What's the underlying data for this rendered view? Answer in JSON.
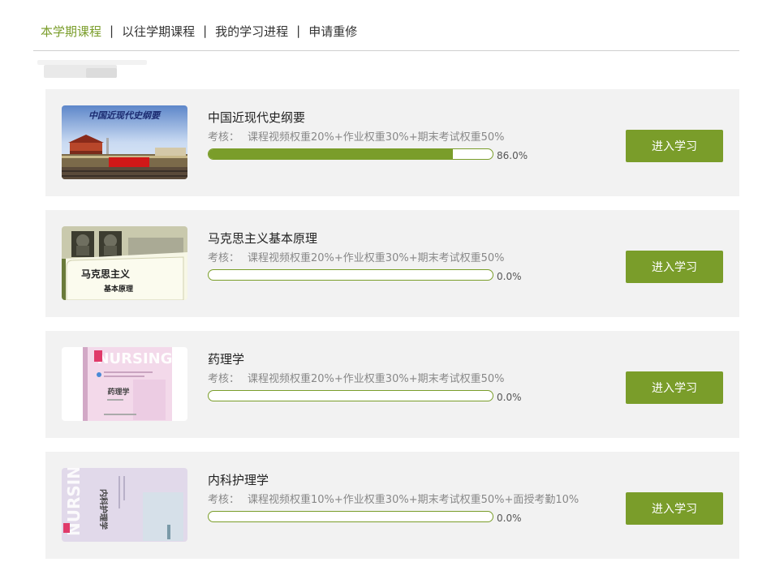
{
  "tabs": [
    {
      "label": "本学期课程",
      "active": true
    },
    {
      "label": "以往学期课程",
      "active": false
    },
    {
      "label": "我的学习进程",
      "active": false
    },
    {
      "label": "申请重修",
      "active": false
    }
  ],
  "tab_separator": "|",
  "colors": {
    "accent": "#7a9d2a",
    "card_bg": "#f2f2f2",
    "muted_text": "#888888"
  },
  "courses": [
    {
      "title": "中国近现代史纲要",
      "assess_label": "考核：",
      "assess": "课程视频权重20%+作业权重30%+期末考试权重50%",
      "progress": 86.0,
      "progress_text": "86.0%",
      "button": "进入学习",
      "cover_text": "中国近现代史纲要"
    },
    {
      "title": "马克思主义基本原理",
      "assess_label": "考核：",
      "assess": "课程视频权重20%+作业权重30%+期末考试权重50%",
      "progress": 0.0,
      "progress_text": "0.0%",
      "button": "进入学习",
      "cover_text_1": "马克思主义",
      "cover_text_2": "基本原理"
    },
    {
      "title": "药理学",
      "assess_label": "考核：",
      "assess": "课程视频权重20%+作业权重30%+期末考试权重50%",
      "progress": 0.0,
      "progress_text": "0.0%",
      "button": "进入学习",
      "cover_brand": "NURSING",
      "cover_text": "药理学"
    },
    {
      "title": "内科护理学",
      "assess_label": "考核：",
      "assess": "课程视频权重10%+作业权重30%+期末考试权重50%+面授考勤10%",
      "progress": 0.0,
      "progress_text": "0.0%",
      "button": "进入学习",
      "cover_brand": "NURSING",
      "cover_text": "内科护理学"
    }
  ]
}
